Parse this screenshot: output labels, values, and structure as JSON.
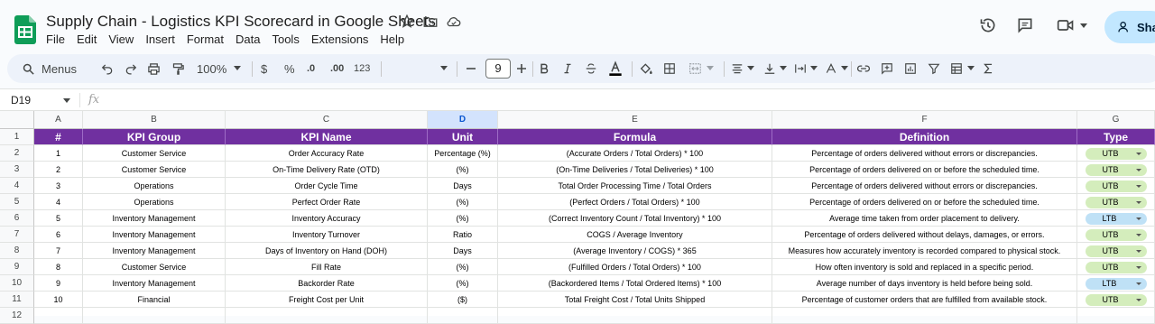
{
  "app": {
    "title": "Supply Chain - Logistics KPI Scorecard in Google Sheets",
    "share_label": "Sha",
    "brand_color": "#0f9d58"
  },
  "menu": [
    "File",
    "Edit",
    "View",
    "Insert",
    "Format",
    "Data",
    "Tools",
    "Extensions",
    "Help"
  ],
  "toolbar": {
    "search_label": "Menus",
    "zoom": "100%",
    "currency": "$",
    "percent": "%",
    "decrease_decimal": ".0",
    "increase_decimal": ".00",
    "number_format": "123",
    "font_size": "9"
  },
  "formula_bar": {
    "name_box": "D19",
    "fx": "fx",
    "value": ""
  },
  "sheet": {
    "column_letters": [
      "A",
      "B",
      "C",
      "D",
      "E",
      "F",
      "G"
    ],
    "selected_column": "D",
    "header_fill": "#7030a0",
    "headers": [
      "#",
      "KPI Group",
      "KPI Name",
      "Unit",
      "Formula",
      "Definition",
      "Type"
    ],
    "rows": [
      {
        "n": "1",
        "group": "Customer Service",
        "name": "Order Accuracy Rate",
        "unit": "Percentage (%)",
        "formula": "(Accurate Orders / Total Orders) * 100",
        "definition": "Percentage of orders delivered without errors or discrepancies.",
        "type": "UTB"
      },
      {
        "n": "2",
        "group": "Customer Service",
        "name": "On-Time Delivery Rate (OTD)",
        "unit": "(%)",
        "formula": "(On-Time Deliveries / Total Deliveries) * 100",
        "definition": "Percentage of orders delivered on or before the scheduled time.",
        "type": "UTB"
      },
      {
        "n": "3",
        "group": "Operations",
        "name": "Order Cycle Time",
        "unit": "Days",
        "formula": "Total Order Processing Time / Total Orders",
        "definition": "Percentage of orders delivered without errors or discrepancies.",
        "type": "UTB"
      },
      {
        "n": "4",
        "group": "Operations",
        "name": "Perfect Order Rate",
        "unit": "(%)",
        "formula": "(Perfect Orders / Total Orders) * 100",
        "definition": "Percentage of orders delivered on or before the scheduled time.",
        "type": "UTB"
      },
      {
        "n": "5",
        "group": "Inventory Management",
        "name": "Inventory Accuracy",
        "unit": "(%)",
        "formula": "(Correct Inventory Count / Total Inventory) * 100",
        "definition": "Average time taken from order placement to delivery.",
        "type": "LTB"
      },
      {
        "n": "6",
        "group": "Inventory Management",
        "name": "Inventory Turnover",
        "unit": "Ratio",
        "formula": "COGS / Average Inventory",
        "definition": "Percentage of orders delivered without delays, damages, or errors.",
        "type": "UTB"
      },
      {
        "n": "7",
        "group": "Inventory Management",
        "name": "Days of Inventory on Hand (DOH)",
        "unit": "Days",
        "formula": "(Average Inventory / COGS) * 365",
        "definition": "Measures how accurately inventory is recorded compared to physical stock.",
        "type": "UTB"
      },
      {
        "n": "8",
        "group": "Customer Service",
        "name": "Fill Rate",
        "unit": "(%)",
        "formula": "(Fulfilled Orders / Total Orders) * 100",
        "definition": "How often inventory is sold and replaced in a specific period.",
        "type": "UTB"
      },
      {
        "n": "9",
        "group": "Inventory Management",
        "name": "Backorder Rate",
        "unit": "(%)",
        "formula": "(Backordered Items / Total Ordered Items) * 100",
        "definition": "Average number of days inventory is held before being sold.",
        "type": "LTB"
      },
      {
        "n": "10",
        "group": "Financial",
        "name": "Freight Cost per Unit",
        "unit": "($)",
        "formula": "Total Freight Cost / Total Units Shipped",
        "definition": "Percentage of customer orders that are fulfilled from available stock.",
        "type": "UTB"
      }
    ],
    "type_colors": {
      "UTB": "#d4edbc",
      "LTB": "#bfe1f6"
    }
  }
}
